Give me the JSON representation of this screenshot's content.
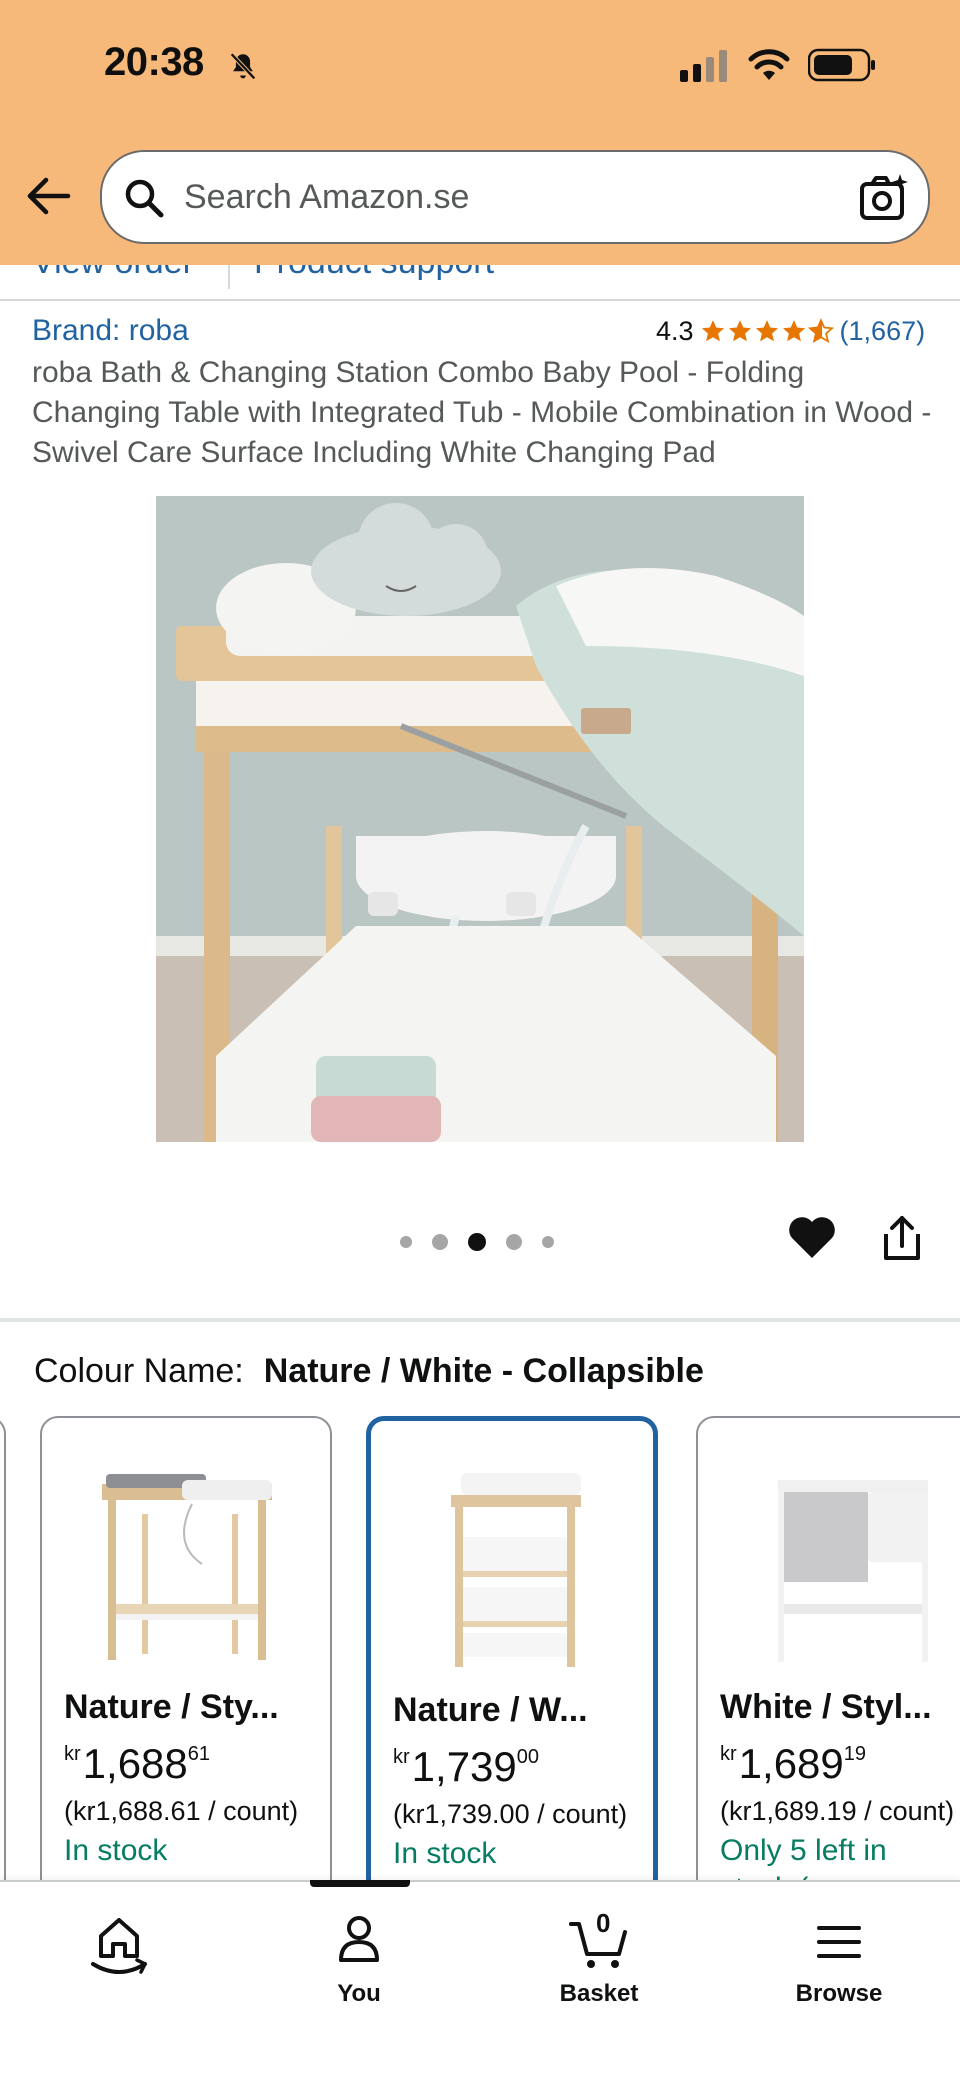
{
  "status_bar": {
    "time": "20:38"
  },
  "search": {
    "placeholder": "Search Amazon.se"
  },
  "partial_tabs": [
    "View order",
    "Product support"
  ],
  "product": {
    "brand": "Brand: roba",
    "rating": "4.3",
    "rating_count": "(1,667)",
    "stars_fraction": 0.86,
    "title": "roba Bath & Changing Station Combo Baby Pool - Folding Changing Table with Integrated Tub - Mobile Combination in Wood - Swivel Care Surface Including White Changing Pad",
    "image_count": 5,
    "image_index": 3
  },
  "colour": {
    "label": "Colour Name:",
    "value": "Nature / White - Collapsible"
  },
  "swatches": [
    {
      "name": "Nature / Sty...",
      "currency": "kr",
      "price_main": "1,688",
      "price_frac": "61",
      "unit": "(kr1,688.61 / count)",
      "stock": "In stock",
      "stock2": "",
      "selected": false
    },
    {
      "name": "Nature / W...",
      "currency": "kr",
      "price_main": "1,739",
      "price_frac": "00",
      "unit": "(kr1,739.00 / count)",
      "stock": "In stock",
      "stock2": "",
      "selected": true
    },
    {
      "name": "White / Styl...",
      "currency": "kr",
      "price_main": "1,689",
      "price_frac": "19",
      "unit": "(kr1,689.19 / count)",
      "stock": "Only 5 left in",
      "stock2": "stock (more on",
      "selected": false
    }
  ],
  "nav": {
    "home": "",
    "you": "You",
    "basket": "Basket",
    "basket_count": "0",
    "browse": "Browse"
  },
  "colors": {
    "header_bg": "#f6b97a",
    "link": "#2162a1",
    "star": "#e77600",
    "in_stock": "#067d62",
    "selected_border": "#2162a1"
  }
}
